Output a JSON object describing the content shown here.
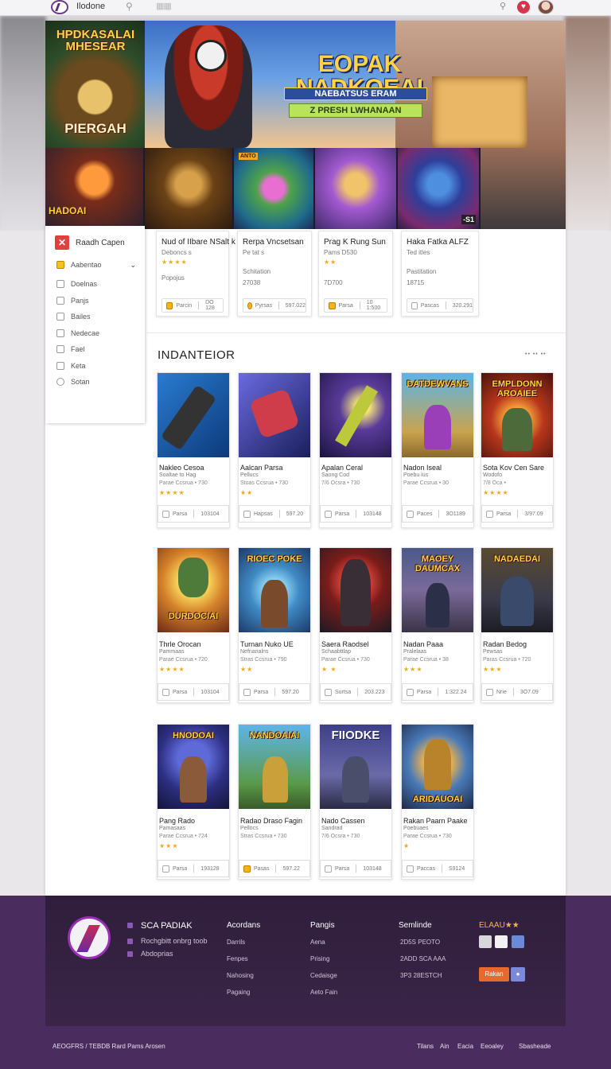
{
  "topbar": {
    "brand": "Ilodone",
    "search_icon": "search-icon",
    "grid_icon": "grid-icon",
    "bell_icon": "bell-icon",
    "heart_icon": "heart-icon"
  },
  "hero": {
    "side_title": "HPDKASALAI MHESEAR",
    "side_sub": "PIERGAH",
    "title": "EOPAK NADKOEAI",
    "subtitle": "NAEBATSUS ERAM",
    "cta": "Z PRESH LWHANAAN",
    "thumbs": [
      {
        "label": "HADOAI",
        "badge": "",
        "corner": ""
      },
      {
        "label": "",
        "badge": "",
        "corner": ""
      },
      {
        "label": "",
        "badge": "ANTO",
        "corner": ""
      },
      {
        "label": "",
        "badge": "",
        "corner": ""
      },
      {
        "label": "",
        "badge": "",
        "corner": "-S1"
      }
    ]
  },
  "sidebar": {
    "head": "Raadh Capen",
    "items": [
      {
        "label": "Aabentao",
        "active": true
      },
      {
        "label": "Doelnas"
      },
      {
        "label": "Panjs"
      },
      {
        "label": "Bailes"
      },
      {
        "label": "Nedecae"
      },
      {
        "label": "Fael"
      },
      {
        "label": "Keta"
      },
      {
        "label": "Sotan"
      }
    ]
  },
  "featured": [
    {
      "title": "Nud of IIbare NSalt k",
      "sub": "Deboncs s",
      "note": "Popojus",
      "price_line": "",
      "foot_label": "Parcin",
      "foot_price": "DO 128"
    },
    {
      "title": "Rerpa Vncsetsan",
      "sub": "Pe tat s",
      "note": "Schitation",
      "price_line": "27038",
      "foot_label": "Pyrsas",
      "foot_price": "597.022"
    },
    {
      "title": "Prag K Rung Sun",
      "sub": "Pams D530",
      "note": "",
      "price_line": "7D700",
      "foot_label": "Parsa",
      "foot_price": "10 1:500"
    },
    {
      "title": "Haka Fatka ALFZ",
      "sub": "Ted itles",
      "note": "Pastitation",
      "price_line": "18715",
      "foot_label": "Pascas",
      "foot_price": "320.291"
    }
  ],
  "section": {
    "title": "INDANTEIOR",
    "more": "•• •• ••"
  },
  "tiles": [
    {
      "art": "",
      "name": "Nakleo Cesoa",
      "sub": "Soaltae to Hag",
      "meta": "Parae Ccsrua • 730",
      "stars": "★★★★",
      "foot_label": "Parsa",
      "foot_price": "103104"
    },
    {
      "art": "",
      "name": "Aalcan Parsa",
      "sub": "Pellucs",
      "meta": "Stoas Ccsrua • 730",
      "stars": "★★",
      "foot_label": "Hapsas",
      "foot_price": "597.20"
    },
    {
      "art": "",
      "name": "Apalan Ceral",
      "sub": "Saong Cod",
      "meta": "7/6 Ocsra • 730",
      "stars": "",
      "foot_label": "Parsa",
      "foot_price": "103148"
    },
    {
      "art": "DATDEWVANS",
      "name": "Nadon Iseal",
      "sub": "Poebu ius",
      "meta": "Parae Ccsrua • 30",
      "stars": "",
      "foot_label": "Paces",
      "foot_price": "3O1189"
    },
    {
      "art": "EMPLDONN AROAIEE",
      "name": "Sota Kov Cen Sare",
      "sub": "Wodofo",
      "meta": "7/8 Oca •",
      "stars": "★★★★",
      "foot_label": "Parsa",
      "foot_price": "3/97.09"
    },
    {
      "art": "DURDOCIAI",
      "name": "Thrle Orocan",
      "sub": "Pammaas",
      "meta": "Parae Ccsrua • 720",
      "stars": "★★★★",
      "foot_label": "Parsa",
      "foot_price": "103104"
    },
    {
      "art": "RIOEC POKE",
      "name": "Turnan Nuko UE",
      "sub": "Nefnanalns",
      "meta": "Stras Ccsrua • 790",
      "stars": "★★",
      "foot_label": "Parsa",
      "foot_price": "597.20"
    },
    {
      "art": "",
      "name": "Saera Raodsel",
      "sub": "Schaabttlap",
      "meta": "Parae Ccsrua • 730",
      "stars": "★ ★",
      "foot_label": "Surtsa",
      "foot_price": "203.223"
    },
    {
      "art": "MAOEY DAUMCAX",
      "name": "Nadan Paaa",
      "sub": "Pralelaas",
      "meta": "Parae Ccsrua • 38",
      "stars": "★★★",
      "foot_label": "Parsa",
      "foot_price": "1:322.24"
    },
    {
      "art": "NADAEDAI",
      "name": "Radan Bedog",
      "sub": "Pewsas",
      "meta": "Paras Ccsrua • 720",
      "stars": "★★★",
      "foot_label": "Nrie",
      "foot_price": "3O7.09"
    },
    {
      "art": "HNODOAI",
      "name": "Pang Rado",
      "sub": "Pamasaas",
      "meta": "Parae Ccsrua • 724",
      "stars": "★★★",
      "foot_label": "Parsa",
      "foot_price": "193128"
    },
    {
      "art": "NANDOAIAI",
      "name": "Radao Draso Fagin",
      "sub": "Pellocs",
      "meta": "Stras Ccsrua • 730",
      "stars": "",
      "foot_label": "Pasas",
      "foot_price": "597.22"
    },
    {
      "art": "FIIODKE",
      "name": "Nado Cassen",
      "sub": "Sandrad",
      "meta": "7/6 Ocsra • 730",
      "stars": "",
      "foot_label": "Parsa",
      "foot_price": "103148"
    },
    {
      "art": "ARIDAUOAI",
      "name": "Rakan Paarn Paake",
      "sub": "Poebuaes",
      "meta": "Parae Ccsrua • 730",
      "stars": "★",
      "foot_label": "Paccas",
      "foot_price": "S9124"
    }
  ],
  "footer": {
    "brand": "SCA PADIAK",
    "lines": [
      "Rochgbitt onbrg toob",
      "Abdoprias"
    ],
    "col1": {
      "title": "Acordans",
      "items": [
        "Darrils",
        "Fenpes",
        "Nahosing",
        "Pagaing"
      ]
    },
    "col2": {
      "title": "Pangis",
      "items": [
        "Aena",
        "Prising",
        "Cedaisge",
        "Aeto Fain"
      ]
    },
    "col3": {
      "title": "Semlinde",
      "items": [
        "2D5S PEOTO",
        "2ADD SCA AAA",
        "3P3 28ESTCH"
      ]
    },
    "col4": {
      "title": "ELAAU★★"
    },
    "button": "Rakan",
    "bottom_left": "AEOGFRS / TEBDB Rard Pams Arosen",
    "bottom_links": [
      "Tilans",
      "Ain",
      "Eacia",
      "Eeoaley",
      "Sbasheade"
    ]
  }
}
